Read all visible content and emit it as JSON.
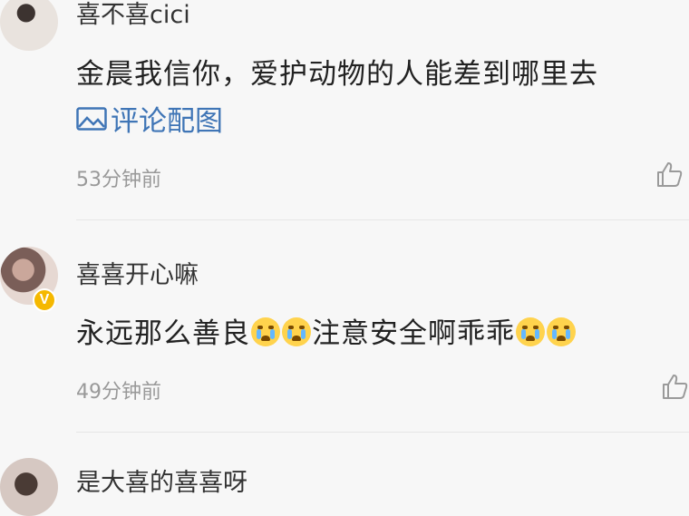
{
  "comments": [
    {
      "username": "喜不喜cici",
      "text": "金晨我信你，爱护动物的人能差到哪里去",
      "image_link": "评论配图",
      "time": "53分钟前",
      "icons": {
        "image": "image-icon",
        "like": "thumbs-up-icon"
      }
    },
    {
      "username": "喜喜开心嘛",
      "text_parts": [
        "永远那么善良",
        "注意安全啊乖乖"
      ],
      "emojis": [
        "crying-emoji",
        "crying-emoji",
        "sobbing-emoji",
        "sobbing-emoji"
      ],
      "verified_badge": "V",
      "time": "49分钟前",
      "icons": {
        "like": "thumbs-up-icon"
      }
    },
    {
      "username": "是大喜的喜喜呀"
    }
  ],
  "colors": {
    "link": "#3f75b6",
    "badge": "#f5b800",
    "time": "#999999"
  }
}
